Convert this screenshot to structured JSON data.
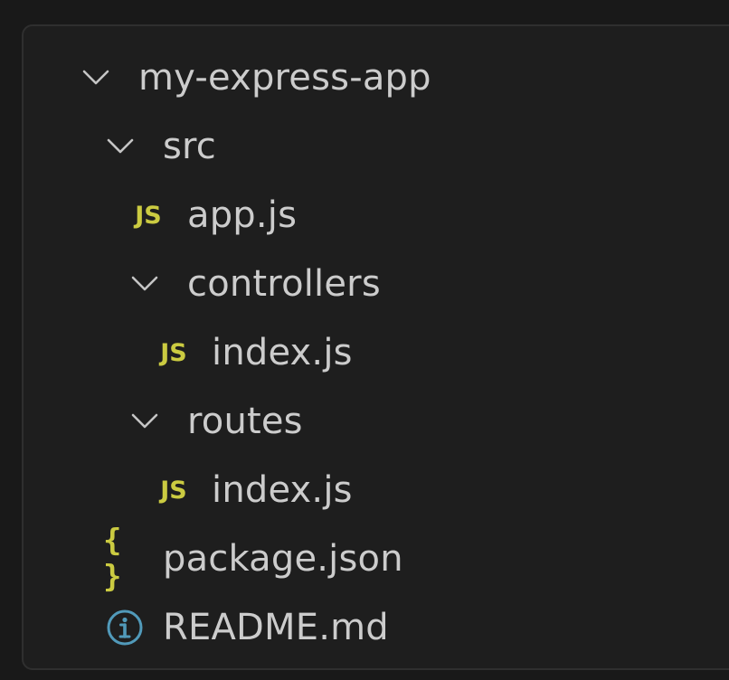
{
  "explorer": {
    "items": [
      {
        "label": "my-express-app",
        "kind": "folder",
        "expanded": true,
        "icon": "chevron-down-icon"
      },
      {
        "label": "src",
        "kind": "folder",
        "expanded": true,
        "icon": "chevron-down-icon"
      },
      {
        "label": "app.js",
        "kind": "file",
        "icon": "javascript-file-icon",
        "badge": "JS"
      },
      {
        "label": "controllers",
        "kind": "folder",
        "expanded": true,
        "icon": "chevron-down-icon"
      },
      {
        "label": "index.js",
        "kind": "file",
        "icon": "javascript-file-icon",
        "badge": "JS"
      },
      {
        "label": "routes",
        "kind": "folder",
        "expanded": true,
        "icon": "chevron-down-icon"
      },
      {
        "label": "index.js",
        "kind": "file",
        "icon": "javascript-file-icon",
        "badge": "JS"
      },
      {
        "label": "package.json",
        "kind": "file",
        "icon": "json-file-icon",
        "badge": "{ }"
      },
      {
        "label": "README.md",
        "kind": "file",
        "icon": "info-icon"
      }
    ]
  },
  "colors": {
    "background": "#1e1e1e",
    "text": "#cccccc",
    "chevron": "#c5c5c5",
    "js_badge": "#cbcb41",
    "info_icon": "#519aba"
  }
}
